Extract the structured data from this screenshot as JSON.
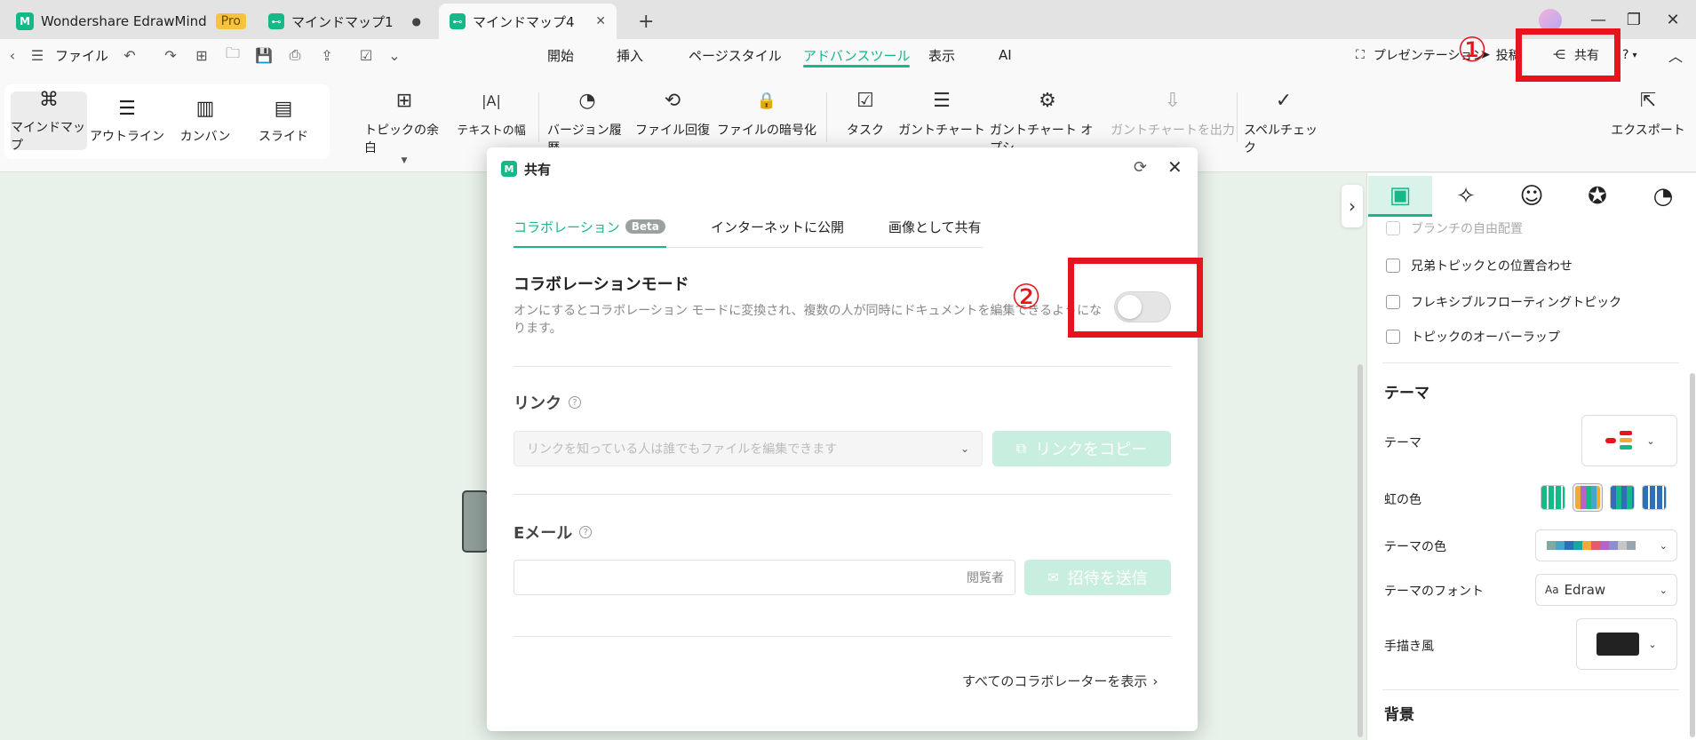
{
  "window": {
    "app_name": "Wondershare EdrawMind",
    "pro_badge": "Pro",
    "tabs": [
      {
        "label": "マインドマップ1",
        "modified_dot": "●"
      },
      {
        "label": "マインドマップ4",
        "close": "✕"
      }
    ],
    "new_tab": "+",
    "minimize": "—",
    "restore": "❐",
    "close": "✕"
  },
  "menubar": {
    "file": "ファイル",
    "tabs": [
      "開始",
      "挿入",
      "ページスタイル",
      "アドバンスツール",
      "表示",
      "AI"
    ],
    "active_tab_index": 3,
    "presentation": "プレゼンテーション",
    "post": "投稿",
    "share": "共有",
    "help": "?"
  },
  "ribbon": {
    "views": [
      "マインドマップ",
      "アウトライン",
      "カンバン",
      "スライド"
    ],
    "selected_view_index": 0,
    "tools": [
      {
        "label": "トピックの余白",
        "icon": "topic-spacing-icon",
        "glyph": "⊞"
      },
      {
        "label": "テキストの幅",
        "icon": "text-width-icon",
        "glyph": "|A|"
      },
      {
        "label": "バージョン履歴",
        "icon": "version-history-icon",
        "glyph": "◔"
      },
      {
        "label": "ファイル回復",
        "icon": "file-recovery-icon",
        "glyph": "⟲"
      },
      {
        "label": "ファイルの暗号化",
        "icon": "file-encrypt-icon",
        "glyph": "🔒"
      },
      {
        "label": "タスク",
        "icon": "task-icon",
        "glyph": "☑"
      },
      {
        "label": "ガントチャート",
        "icon": "gantt-chart-icon",
        "glyph": "☰"
      },
      {
        "label": "ガントチャート オプシ...",
        "icon": "gantt-options-icon",
        "glyph": "⚙"
      },
      {
        "label": "ガントチャートを出力",
        "icon": "gantt-export-icon",
        "glyph": "⇩",
        "disabled": true
      },
      {
        "label": "スペルチェック",
        "icon": "spellcheck-icon",
        "glyph": "✓"
      }
    ],
    "export": "エクスポート"
  },
  "dialog": {
    "title": "共有",
    "tabs": [
      "コラボレーション",
      "インターネットに公開",
      "画像として共有"
    ],
    "beta": "Beta",
    "collab_mode_title": "コラボレーションモード",
    "collab_mode_desc": "オンにするとコラボレーション モードに変換され、複数の人が同時にドキュメントを編集できるようになります。",
    "collab_mode_on": false,
    "link_label": "リンク",
    "link_select": "リンクを知っている人は誰でもファイルを編集できます",
    "copy_link": "リンクをコピー",
    "email_label": "Eメール",
    "email_placeholder": "",
    "role": "閲覧者",
    "send_invite": "招待を送信",
    "show_all": "すべてのコラボレーターを表示"
  },
  "annotations": {
    "step1": "①",
    "step2": "②",
    "color": "#e8141c"
  },
  "panel": {
    "checkboxes": [
      {
        "label": "ブランチの自由配置",
        "disabled": true
      },
      {
        "label": "兄弟トピックとの位置合わせ"
      },
      {
        "label": "フレキシブルフローティングトピック"
      },
      {
        "label": "トピックのオーバーラップ"
      }
    ],
    "theme_section": "テーマ",
    "theme_label": "テーマ",
    "rainbow_label": "虹の色",
    "theme_color_label": "テーマの色",
    "theme_font_label": "テーマのフォント",
    "theme_font_value": "Edraw",
    "theme_font_prefix": "Aa",
    "handdrawn_label": "手描き風",
    "background_section": "背景"
  },
  "colors": {
    "accent": "#14b889",
    "annotation_red": "#e8141c",
    "theme_palette": [
      "#7fa8a0",
      "#4aa3c8",
      "#2f6fb7",
      "#1aa5a0",
      "#f2a83b",
      "#e55b6e",
      "#b466c8",
      "#8a8fd0",
      "#c6c6c6",
      "#9aa4b0"
    ]
  }
}
